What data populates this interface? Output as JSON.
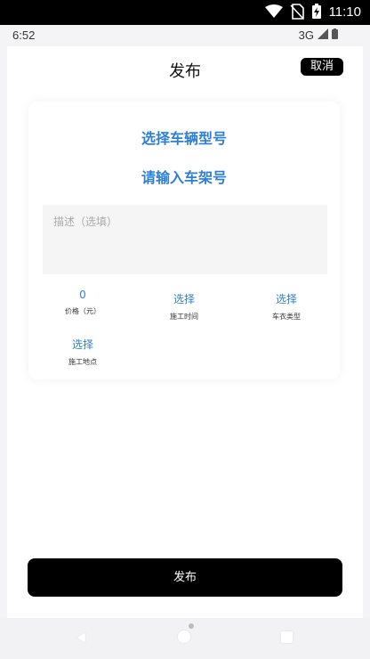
{
  "system_status": {
    "time": "11:10"
  },
  "inner_status": {
    "time": "6:52",
    "network": "3G"
  },
  "header": {
    "title": "发布",
    "cancel_label": "取消"
  },
  "form": {
    "vehicle_model_label": "选择车辆型号",
    "frame_number_label": "请输入车架号",
    "description_placeholder": "描述（选填）",
    "fields": [
      {
        "value": "0",
        "label": "价格（元）"
      },
      {
        "value": "选择",
        "label": "施工时间"
      },
      {
        "value": "选择",
        "label": "车衣类型"
      },
      {
        "value": "选择",
        "label": "施工地点"
      }
    ]
  },
  "publish_label": "发布",
  "colors": {
    "accent_link": "#2f7fd6",
    "button_bg": "#000000"
  }
}
